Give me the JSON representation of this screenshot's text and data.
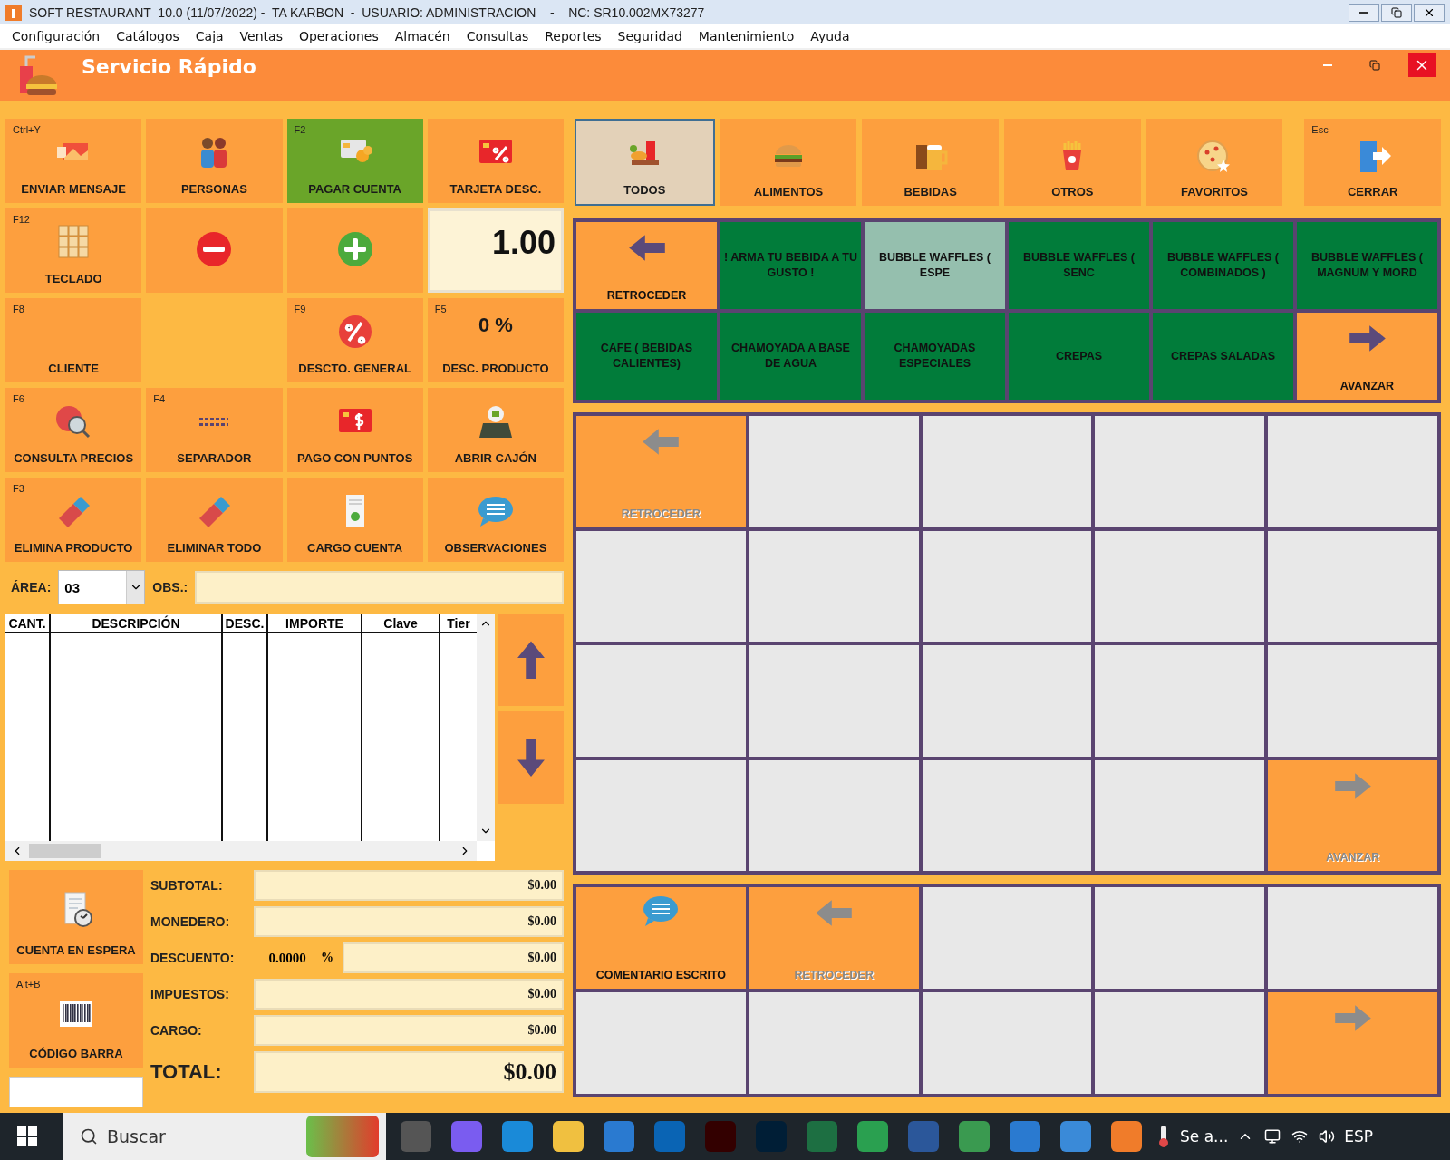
{
  "window": {
    "title": "SOFT RESTAURANT  10.0 (11/07/2022) -  TA KARBON  -  USUARIO: ADMINISTRACION    -    NC: SR10.002MX73277"
  },
  "menu": [
    "Configuración",
    "Catálogos",
    "Caja",
    "Ventas",
    "Operaciones",
    "Almacén",
    "Consultas",
    "Reportes",
    "Seguridad",
    "Mantenimiento",
    "Ayuda"
  ],
  "panel": {
    "title": "Servicio Rápido"
  },
  "actions": [
    {
      "kind": "button",
      "label": "ENVIAR MENSAJE",
      "shortcut": "Ctrl+Y",
      "highlighted": false
    },
    {
      "kind": "button",
      "label": "PERSONAS",
      "highlighted": false
    },
    {
      "kind": "button",
      "label": "PAGAR CUENTA",
      "shortcut": "F2",
      "highlighted": true
    },
    {
      "kind": "button",
      "label": "TARJETA DESC.",
      "highlighted": false
    },
    {
      "kind": "button",
      "label": "TECLADO",
      "shortcut": "F12",
      "highlighted": false
    },
    {
      "kind": "button",
      "highlighted": false
    },
    {
      "kind": "button",
      "highlighted": false
    },
    {
      "kind": "quantity",
      "value": "1.00"
    },
    {
      "kind": "button",
      "label": "CLIENTE",
      "shortcut": "F8",
      "highlighted": false
    },
    {
      "kind": "spacer"
    },
    {
      "kind": "button",
      "label": "DESCTO. GENERAL",
      "shortcut": "F9",
      "highlighted": false
    },
    {
      "kind": "button",
      "label": "DESC. PRODUCTO",
      "shortcut": "F5",
      "value": "0 %",
      "highlighted": false
    },
    {
      "kind": "button",
      "label": "CONSULTA PRECIOS",
      "shortcut": "F6",
      "highlighted": false
    },
    {
      "kind": "button",
      "label": "SEPARADOR",
      "shortcut": "F4",
      "highlighted": false
    },
    {
      "kind": "button",
      "label": "PAGO CON PUNTOS",
      "highlighted": false
    },
    {
      "kind": "button",
      "label": "ABRIR CAJÓN",
      "highlighted": false
    },
    {
      "kind": "button",
      "label": "ELIMINA PRODUCTO",
      "shortcut": "F3",
      "highlighted": false
    },
    {
      "kind": "button",
      "label": "ELIMINAR TODO",
      "highlighted": false
    },
    {
      "kind": "button",
      "label": "CARGO CUENTA",
      "highlighted": false
    },
    {
      "kind": "button",
      "label": "OBSERVACIONES",
      "highlighted": false
    }
  ],
  "area": {
    "label": "ÁREA:",
    "value": "03"
  },
  "obs": {
    "label": "OBS.:"
  },
  "table": {
    "columns": [
      "CANT.",
      "DESCRIPCIÓN",
      "DESC.",
      "IMPORTE",
      "Clave",
      "Tier"
    ]
  },
  "hold_button": {
    "label": "CUENTA EN ESPERA"
  },
  "barcode_button": {
    "label": "CÓDIGO BARRA",
    "shortcut": "Alt+B"
  },
  "totals": [
    {
      "kind": "amount",
      "label": "SUBTOTAL:",
      "value": "$0.00"
    },
    {
      "kind": "amount",
      "label": "MONEDERO:",
      "value": "$0.00"
    },
    {
      "kind": "discount",
      "label": "DESCUENTO:",
      "percent": "0.0000",
      "percent_sign": "%",
      "value": "$0.00"
    },
    {
      "kind": "amount",
      "label": "IMPUESTOS:",
      "value": "$0.00"
    },
    {
      "kind": "amount",
      "label": "CARGO:",
      "value": "$0.00"
    },
    {
      "kind": "total",
      "label": "TOTAL:",
      "value": "$0.00"
    }
  ],
  "categories": [
    {
      "label": "TODOS",
      "selected": true
    },
    {
      "label": "ALIMENTOS",
      "selected": false
    },
    {
      "label": "BEBIDAS",
      "selected": false
    },
    {
      "label": "OTROS",
      "selected": false
    },
    {
      "label": "FAVORITOS",
      "selected": false
    }
  ],
  "close_button": {
    "label": "CERRAR",
    "shortcut": "Esc"
  },
  "groups": [
    {
      "kind": "back",
      "label": "RETROCEDER",
      "disabled": false
    },
    {
      "kind": "group",
      "label": "! ARMA TU  BEBIDA A TU GUSTO !",
      "selected": false
    },
    {
      "kind": "group",
      "label": "BUBBLE WAFFLES          ( ESPE",
      "selected": true
    },
    {
      "kind": "group",
      "label": "BUBBLE WAFFLES          ( SENC",
      "selected": false
    },
    {
      "kind": "group",
      "label": "BUBBLE WAFFLES  ( COMBINADOS )",
      "selected": false
    },
    {
      "kind": "group",
      "label": "BUBBLE WAFFLES ( MAGNUM Y MORD",
      "selected": false
    },
    {
      "kind": "group",
      "label": "CAFE ( BEBIDAS CALIENTES)",
      "selected": false
    },
    {
      "kind": "group",
      "label": "CHAMOYADA A BASE DE AGUA",
      "selected": false
    },
    {
      "kind": "group",
      "label": "CHAMOYADAS ESPECIALES",
      "selected": false
    },
    {
      "kind": "group",
      "label": "CREPAS",
      "selected": false
    },
    {
      "kind": "group",
      "label": "CREPAS SALADAS",
      "selected": false
    },
    {
      "kind": "next",
      "label": "AVANZAR",
      "disabled": false
    }
  ],
  "products": [
    {
      "kind": "back",
      "label": "RETROCEDER",
      "disabled": true
    },
    {
      "kind": "empty"
    },
    {
      "kind": "empty"
    },
    {
      "kind": "empty"
    },
    {
      "kind": "empty"
    },
    {
      "kind": "empty"
    },
    {
      "kind": "empty"
    },
    {
      "kind": "empty"
    },
    {
      "kind": "empty"
    },
    {
      "kind": "empty"
    },
    {
      "kind": "empty"
    },
    {
      "kind": "empty"
    },
    {
      "kind": "empty"
    },
    {
      "kind": "empty"
    },
    {
      "kind": "empty"
    },
    {
      "kind": "empty"
    },
    {
      "kind": "empty"
    },
    {
      "kind": "empty"
    },
    {
      "kind": "empty"
    },
    {
      "kind": "next",
      "label": "AVANZAR",
      "disabled": true
    }
  ],
  "modifiers": [
    {
      "kind": "comment",
      "label": "COMENTARIO ESCRITO"
    },
    {
      "kind": "back",
      "label": "RETROCEDER",
      "disabled": true
    },
    {
      "kind": "empty"
    },
    {
      "kind": "empty"
    },
    {
      "kind": "empty"
    },
    {
      "kind": "empty"
    },
    {
      "kind": "empty"
    },
    {
      "kind": "empty"
    },
    {
      "kind": "empty"
    },
    {
      "kind": "next",
      "disabled": true
    }
  ],
  "taskbar": {
    "search_placeholder": "Buscar",
    "weather": "Se a...",
    "language": "ESP"
  }
}
